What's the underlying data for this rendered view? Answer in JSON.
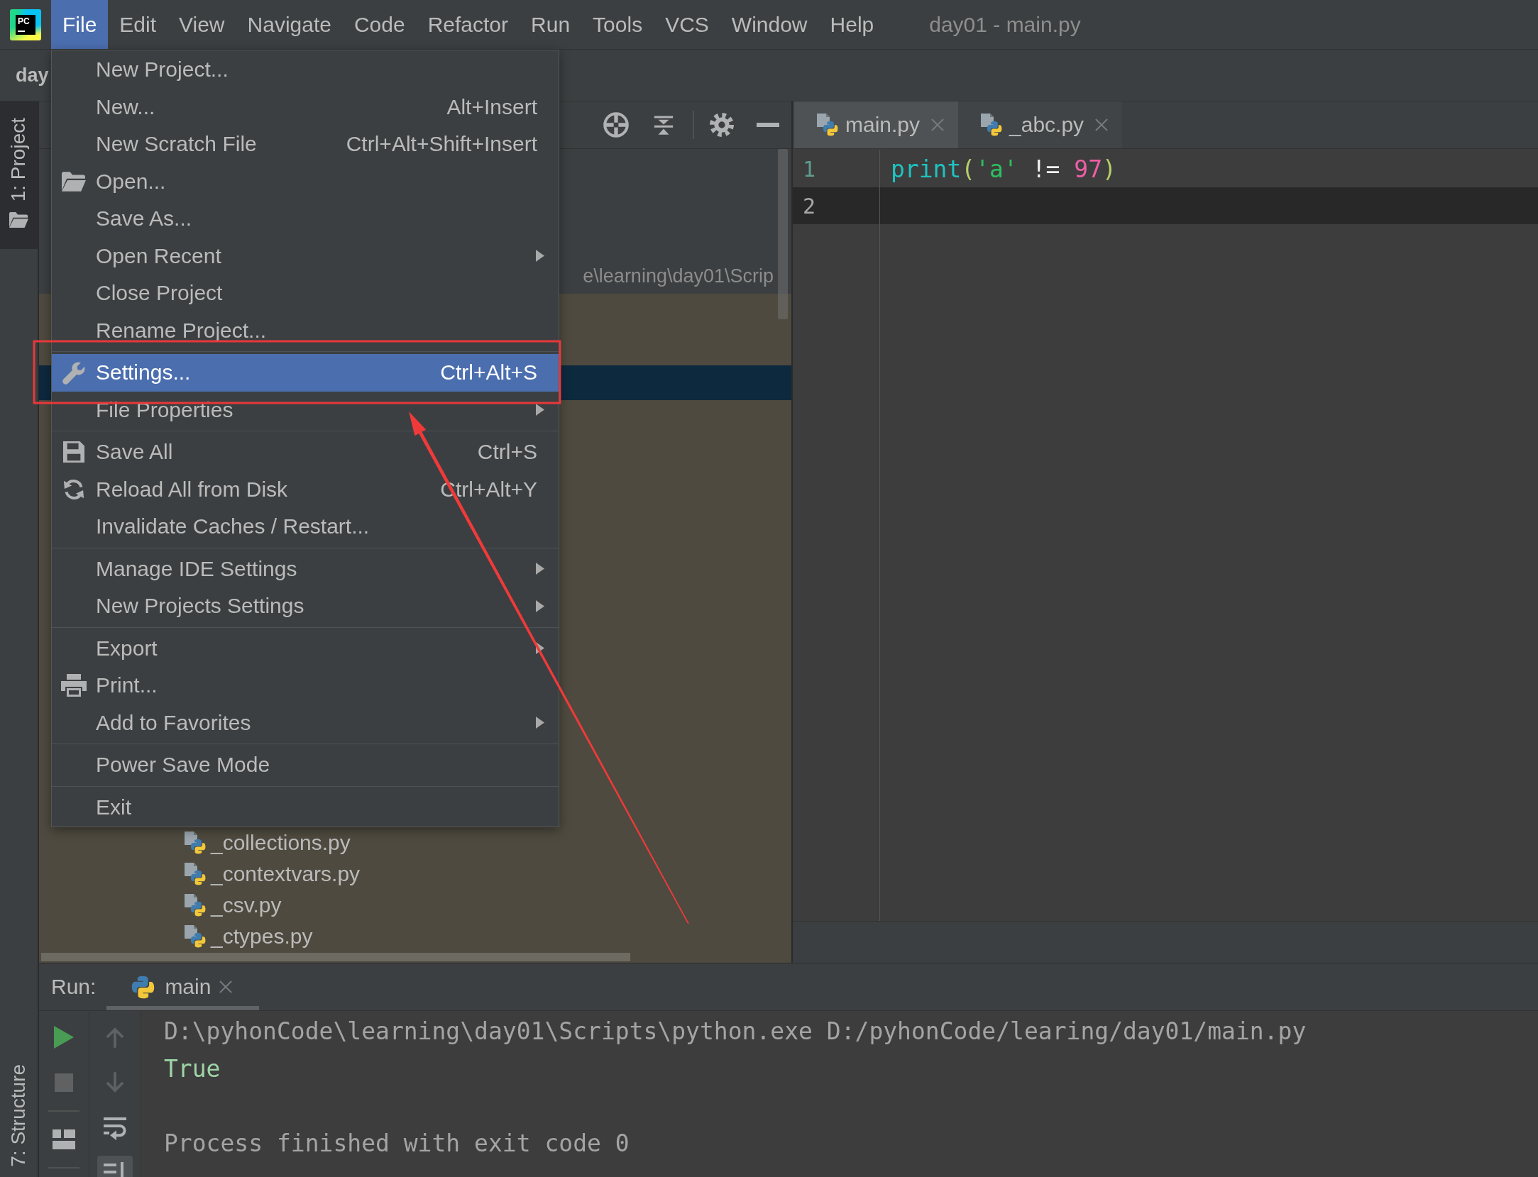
{
  "menu_bar": {
    "logo": {
      "text": "PC"
    },
    "menus": [
      {
        "label": "File",
        "selected": true
      },
      {
        "label": "Edit",
        "selected": false
      },
      {
        "label": "View",
        "selected": false
      },
      {
        "label": "Navigate",
        "selected": false
      },
      {
        "label": "Code",
        "selected": false
      },
      {
        "label": "Refactor",
        "selected": false
      },
      {
        "label": "Run",
        "selected": false
      },
      {
        "label": "Tools",
        "selected": false
      },
      {
        "label": "VCS",
        "selected": false
      },
      {
        "label": "Window",
        "selected": false
      },
      {
        "label": "Help",
        "selected": false
      }
    ],
    "title": "day01 - main.py"
  },
  "file_menu": {
    "groups": [
      {
        "items": [
          {
            "label": "New Project...",
            "kind": "plain",
            "selected": false,
            "submenu": false
          },
          {
            "label": "New...",
            "shortcut": "Alt+Insert",
            "kind": "plain",
            "selected": false,
            "submenu": false
          },
          {
            "label": "New Scratch File",
            "shortcut": "Ctrl+Alt+Shift+Insert",
            "kind": "plain",
            "selected": false,
            "submenu": false
          },
          {
            "label": "Open...",
            "kind": "folder",
            "selected": false,
            "submenu": false
          },
          {
            "label": "Save As...",
            "kind": "plain",
            "selected": false,
            "submenu": false
          },
          {
            "label": "Open Recent",
            "kind": "plain",
            "selected": false,
            "submenu": true
          },
          {
            "label": "Close Project",
            "kind": "plain",
            "selected": false,
            "submenu": false
          },
          {
            "label": "Rename Project...",
            "kind": "plain",
            "selected": false,
            "submenu": false
          }
        ]
      },
      {
        "items": [
          {
            "label": "Settings...",
            "shortcut": "Ctrl+Alt+S",
            "kind": "wrench",
            "selected": true,
            "submenu": false
          },
          {
            "label": "File Properties",
            "kind": "plain",
            "selected": false,
            "submenu": true
          }
        ]
      },
      {
        "items": [
          {
            "label": "Save All",
            "shortcut": "Ctrl+S",
            "kind": "floppy",
            "selected": false,
            "submenu": false
          },
          {
            "label": "Reload All from Disk",
            "shortcut": "Ctrl+Alt+Y",
            "kind": "reload",
            "selected": false,
            "submenu": false
          },
          {
            "label": "Invalidate Caches / Restart...",
            "kind": "plain",
            "selected": false,
            "submenu": false
          }
        ]
      },
      {
        "items": [
          {
            "label": "Manage IDE Settings",
            "kind": "plain",
            "selected": false,
            "submenu": true
          },
          {
            "label": "New Projects Settings",
            "kind": "plain",
            "selected": false,
            "submenu": true
          }
        ]
      },
      {
        "items": [
          {
            "label": "Export",
            "kind": "plain",
            "selected": false,
            "submenu": true
          },
          {
            "label": "Print...",
            "kind": "printer",
            "selected": false,
            "submenu": false
          },
          {
            "label": "Add to Favorites",
            "kind": "plain",
            "selected": false,
            "submenu": true
          }
        ]
      },
      {
        "items": [
          {
            "label": "Power Save Mode",
            "kind": "plain",
            "selected": false,
            "submenu": false
          }
        ]
      },
      {
        "items": [
          {
            "label": "Exit",
            "kind": "plain",
            "selected": false,
            "submenu": false
          }
        ]
      }
    ]
  },
  "navigation_bar": {
    "breadcrumb": "day"
  },
  "tool_window_tabs": {
    "top": [
      {
        "label": "1: Project",
        "kind": "folder",
        "selected": true
      }
    ],
    "bottom": [
      {
        "label": "7: Structure",
        "selected": false
      }
    ]
  },
  "project_panel": {
    "path_text": "e\\learning\\day01\\Scrip",
    "tree_items": [
      {
        "label": "_collections.py"
      },
      {
        "label": "_contextvars.py"
      },
      {
        "label": "_csv.py"
      },
      {
        "label": "_ctypes.py"
      }
    ]
  },
  "editor": {
    "tabs": [
      {
        "label": "main.py",
        "selected": true
      },
      {
        "label": "_abc.py",
        "selected": false
      }
    ],
    "lines": [
      {
        "number": "1",
        "current": false,
        "tokens": [
          {
            "text": "print",
            "kind": "function"
          },
          {
            "text": "(",
            "kind": "paren"
          },
          {
            "text": "'a'",
            "kind": "string"
          },
          {
            "text": " != ",
            "kind": "operator"
          },
          {
            "text": "97",
            "kind": "number"
          },
          {
            "text": ")",
            "kind": "paren"
          }
        ]
      },
      {
        "number": "2",
        "current": true
      }
    ]
  },
  "run_panel": {
    "title": "Run:",
    "tabs": [
      {
        "label": "main",
        "selected": true
      }
    ],
    "toolbar_columns": [
      {
        "groups": [
          [
            {
              "kind": "play",
              "disabled": false,
              "on": false
            },
            {
              "kind": "stop",
              "disabled": true,
              "on": false
            }
          ],
          [
            {
              "kind": "layout",
              "disabled": false,
              "on": false
            }
          ]
        ]
      },
      {
        "groups": [
          [
            {
              "kind": "up",
              "disabled": true,
              "on": false
            },
            {
              "kind": "down",
              "disabled": true,
              "on": false
            },
            {
              "kind": "soft_wrap",
              "disabled": false,
              "on": false
            },
            {
              "kind": "scroll_to_end",
              "disabled": false,
              "on": true
            }
          ]
        ]
      }
    ],
    "console": [
      {
        "kind": "command",
        "text": "D:\\pyhonCode\\learning\\day01\\Scripts\\python.exe D:/pyhonCode/learing/day01/main.py"
      },
      {
        "kind": "output",
        "text": "True"
      },
      {
        "kind": "blank"
      },
      {
        "kind": "system",
        "text": "Process finished with exit code 0"
      }
    ]
  }
}
